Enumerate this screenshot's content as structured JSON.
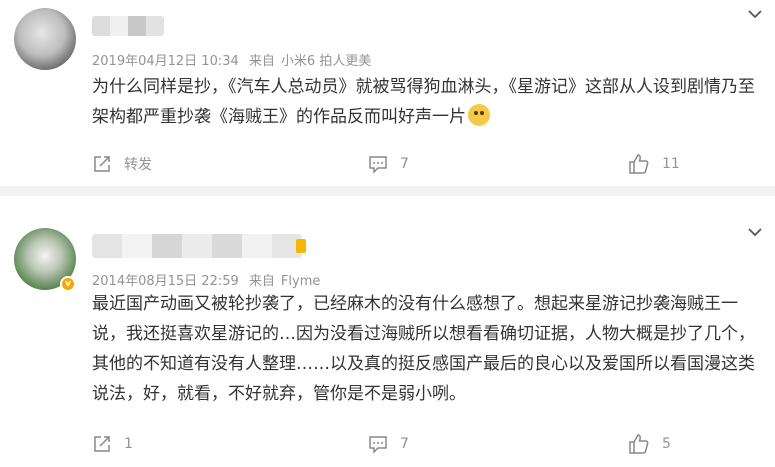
{
  "comments": [
    {
      "meta": {
        "date": "2019年04月12日 10:34",
        "source_label": "来自",
        "source": "小米6 拍人更美"
      },
      "content": "为什么同样是抄，《汽车人总动员》就被骂得狗血淋头，《星游记》这部从人设到剧情乃至架构都严重抄袭《海贼王》的作品反而叫好声一片",
      "actions": {
        "repost": "转发",
        "comment": "7",
        "like": "11"
      }
    },
    {
      "meta": {
        "date": "2014年08月15日 22:59",
        "source_label": "来自",
        "source": "Flyme"
      },
      "content": "最近国产动画又被轮抄袭了，已经麻木的没有什么感想了。想起来星游记抄袭海贼王一说，我还挺喜欢星游记的…因为没看过海贼所以想看看确切证据，人物大概是抄了几个，其他的不知道有没有人整理……以及真的挺反感国产最后的良心以及爱国所以看国漫这类说法，好，就看，不好就弃，管你是不是弱小咧。",
      "actions": {
        "repost": "1",
        "comment": "7",
        "like": "5"
      }
    }
  ],
  "colors": {
    "meta_text": "#939393",
    "body_text": "#333333",
    "separator": "#f2f2f5",
    "vip_badge": "#f7a800"
  },
  "icons": [
    "chevron-down-icon",
    "repost-icon",
    "comment-icon",
    "like-icon",
    "vip-badge-icon",
    "emoji-icon"
  ]
}
